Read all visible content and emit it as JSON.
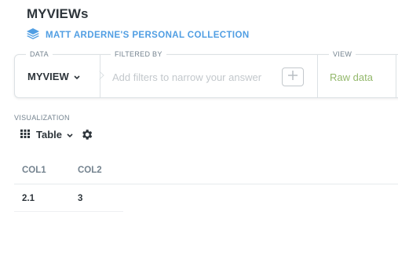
{
  "header": {
    "title": "MYVIEWs",
    "collection_label": "MATT ARDERNE'S PERSONAL COLLECTION"
  },
  "query": {
    "data_label": "DATA",
    "data_value": "MYVIEW",
    "filter_label": "FILTERED BY",
    "filter_placeholder": "Add filters to narrow your answer",
    "view_label": "VIEW",
    "view_value": "Raw data"
  },
  "visualization": {
    "label": "VISUALIZATION",
    "type": "Table"
  },
  "table": {
    "columns": [
      "COL1",
      "COL2"
    ],
    "rows": [
      [
        "2.1",
        "3"
      ]
    ]
  },
  "colors": {
    "brand": "#509ee3",
    "view_green": "#93b86b",
    "text": "#2e353b",
    "muted": "#74838f"
  }
}
